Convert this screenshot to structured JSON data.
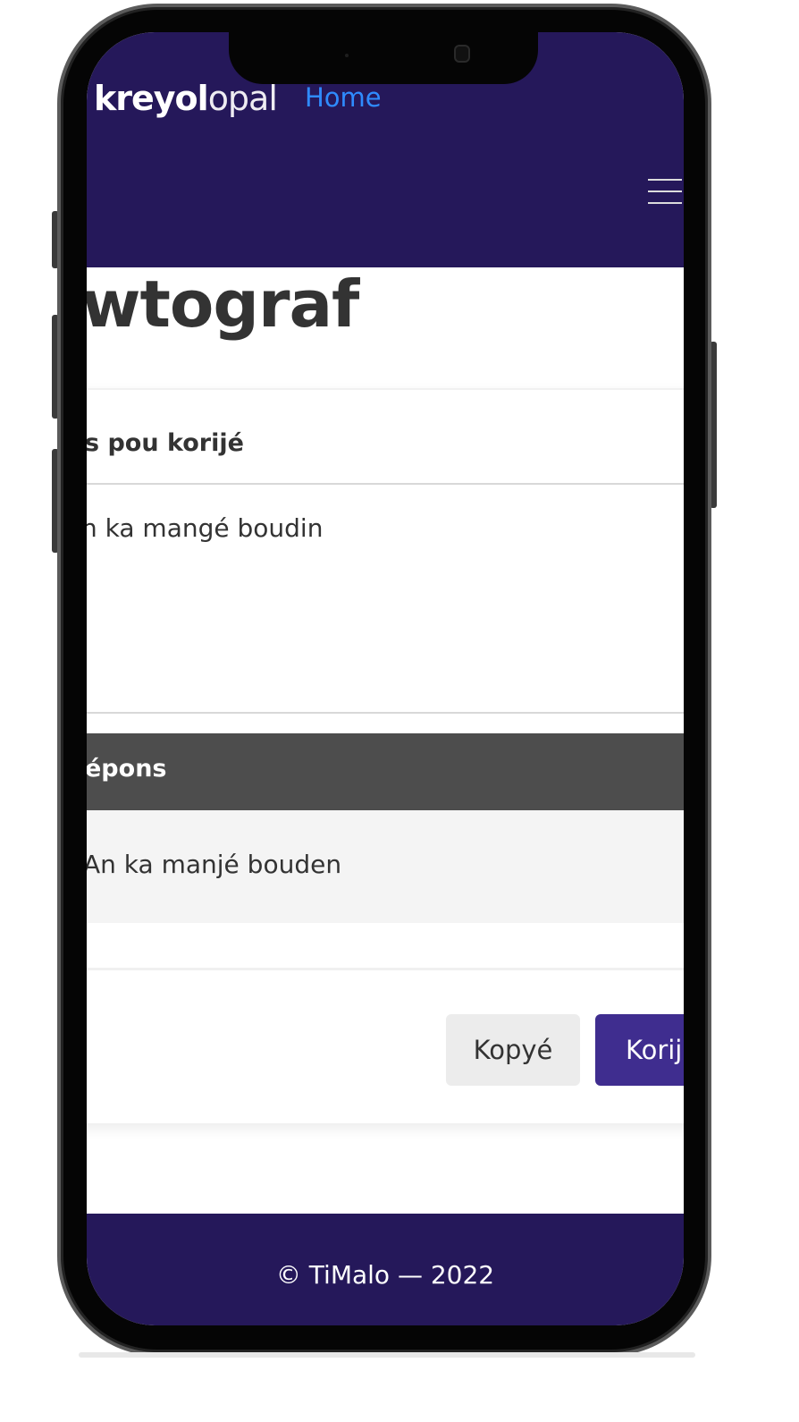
{
  "brand": {
    "logo_bold": "kreyol",
    "logo_light": "opal"
  },
  "nav": {
    "home_label": "Home"
  },
  "page": {
    "title": "wtograf"
  },
  "input_section": {
    "label": "s pou korijé",
    "text": "n ka mangé boudin"
  },
  "response_section": {
    "label": "épons",
    "text": "An ka manjé bouden"
  },
  "actions": {
    "copy_label": "Kopyé",
    "correct_label": "Korijé"
  },
  "footer": {
    "text": "© TiMalo — 2022"
  },
  "colors": {
    "header_bg": "#25185a",
    "nav_link": "#2f8bff",
    "primary_button": "#3f2d8f",
    "response_header_bg": "#4d4d4d"
  }
}
